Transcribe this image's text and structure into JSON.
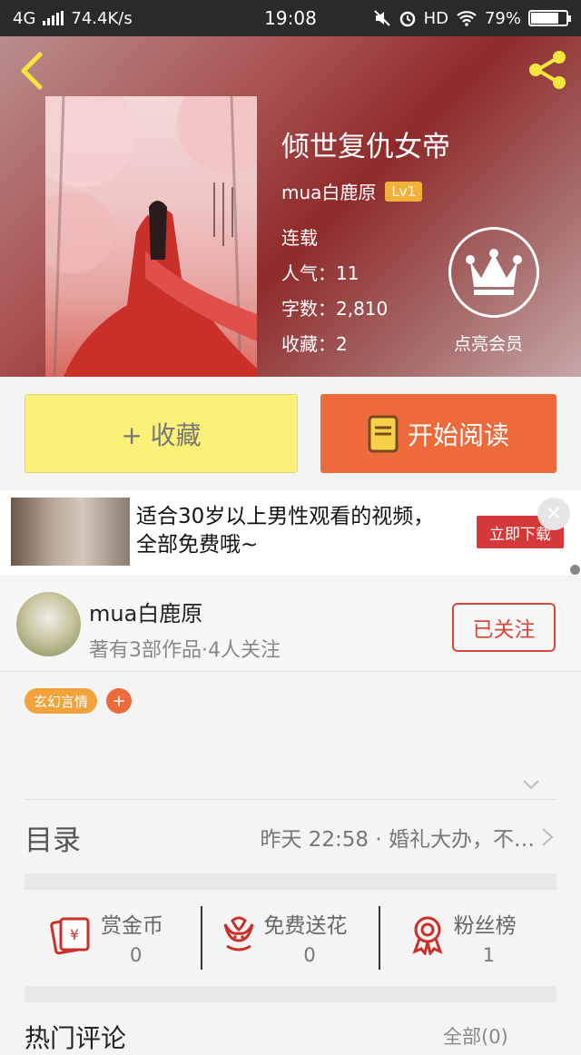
{
  "statusbar": {
    "network": "4G",
    "speed": "74.4K/s",
    "time": "19:08",
    "hd": "HD",
    "battery": "79%",
    "battery_level": 0.79
  },
  "book": {
    "title": "倾世复仇女帝",
    "author": "mua白鹿原",
    "level": "Lv1",
    "status": "连载",
    "popularity": "人气：11",
    "words": "字数：2,810",
    "collections": "收藏：2",
    "vip_label": "点亮会员"
  },
  "actions": {
    "favorite": "+ 收藏",
    "read": "开始阅读"
  },
  "ad": {
    "line1": "适合30岁以上男性观看的视频，",
    "line2": "全部免费哦~",
    "button": "立即下载"
  },
  "author_card": {
    "name": "mua白鹿原",
    "subtitle": "著有3部作品·4人关注",
    "follow": "已关注"
  },
  "tags": [
    "玄幻言情"
  ],
  "toc": {
    "label": "目录",
    "latest": "昨天 22:58 · 婚礼大办，不…"
  },
  "stats": [
    {
      "name": "赏金币",
      "value": "0",
      "icon": "red-envelope-icon"
    },
    {
      "name": "免费送花",
      "value": "0",
      "icon": "flower-icon"
    },
    {
      "name": "粉丝榜",
      "value": "1",
      "icon": "medal-icon"
    }
  ],
  "comments": {
    "title": "热门评论",
    "right": "全部(0)"
  },
  "colors": {
    "accent_orange": "#ec6a3b",
    "fav_yellow": "#fbf078",
    "level_gold": "#f2b23a",
    "follow_red": "#d9473a"
  }
}
